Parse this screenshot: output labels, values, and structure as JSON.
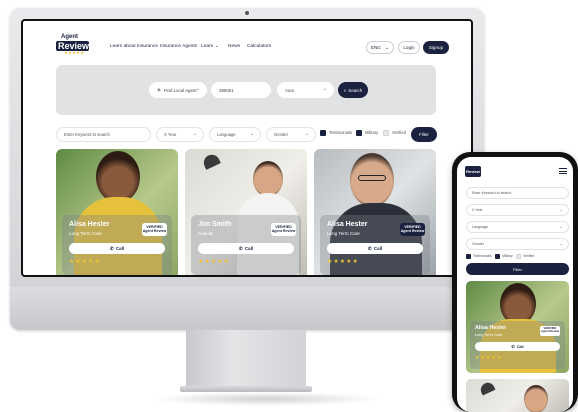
{
  "nav": {
    "logo_top": "Agent",
    "logo_bottom": "Review",
    "logo_stars": "★★★★★",
    "links": [
      "Learn about Insurance",
      "Insurance Agents",
      "Learn ⌄",
      "News",
      "Calculators"
    ],
    "language": "ENG",
    "login": "Login",
    "signup": "Signup"
  },
  "search": {
    "find_label": "Find Local Agent",
    "zip_value": "380001",
    "auto_label": "Auto",
    "search_label": "Search"
  },
  "filters": {
    "keyword_placeholder": "Enter Keyword to search",
    "year_label": "X Year",
    "language_label": "Language",
    "gender_label": "Gender",
    "testimonials": "Testimonials",
    "military": "Military",
    "verified": "Verified",
    "filter_button": "Filter"
  },
  "agents": [
    {
      "name": "Alisa Hester",
      "specialty": "Long Term Care",
      "call": "Call",
      "stars": "★★★★★"
    },
    {
      "name": "Jim Smith",
      "specialty": "Annuity",
      "call": "Call",
      "stars": "★★★★★"
    },
    {
      "name": "Alisa Hester",
      "specialty": "Long Term Care",
      "call": "Call",
      "stars": "★★★★★"
    }
  ],
  "badge": {
    "line1": "VERIFIED",
    "line2": "Agent Review"
  },
  "mobile": {
    "keyword_placeholder": "Enter Keyword to search",
    "year_label": "X Year",
    "language_label": "Language",
    "gender_label": "Gender",
    "testimonials": "Testimonials",
    "military": "Military",
    "verified": "Verified",
    "filter_button": "Filter",
    "card": {
      "name": "Alisa Hester",
      "specialty": "Long Term Care",
      "call": "Call",
      "stars": "★★★★★"
    }
  },
  "colors": {
    "navy": "#1b2240",
    "star": "#f1c232",
    "banner": "#e1e2e4"
  }
}
